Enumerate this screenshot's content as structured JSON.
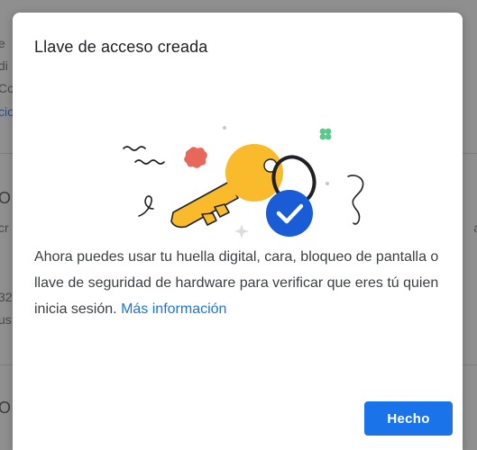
{
  "background": {
    "fragments": [
      "e",
      "di",
      "Co",
      "cio",
      "O",
      "cr",
      "32",
      "us",
      "O"
    ],
    "right_fragment": "a"
  },
  "dialog": {
    "title": "Llave de acceso creada",
    "body_text": "Ahora puedes usar tu huella digital, cara, bloqueo de pantalla o llave de seguridad de hardware para verificar que eres tú quien inicia sesión.",
    "link_text": "Más información",
    "done_label": "Hecho"
  },
  "illustration": {
    "key_color": "#F9BA2C",
    "check_badge_color": "#1A5BD6",
    "accent_red": "#E8675B",
    "accent_green": "#5BC98A",
    "icons": [
      "key-icon",
      "check-badge-icon"
    ]
  },
  "colors": {
    "primary": "#1a73e8",
    "title_text": "#202124",
    "body_text": "#3c4043"
  }
}
